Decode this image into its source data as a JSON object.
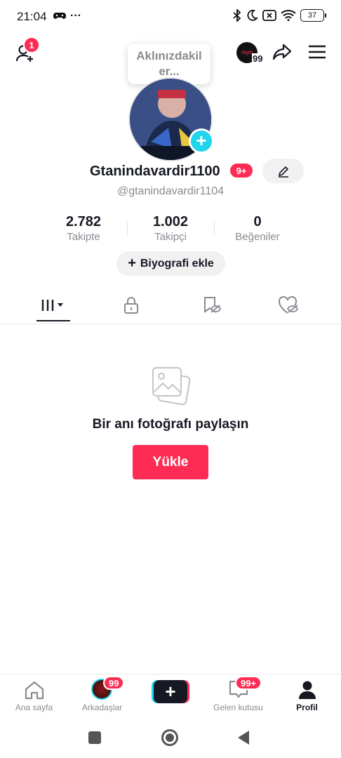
{
  "status_bar": {
    "time": "21:04",
    "dots": "···",
    "battery": "37"
  },
  "top_bar": {
    "add_friend_badge": "1",
    "story_count": "99",
    "avatar_small_text": "Night"
  },
  "bubble": {
    "text_line1": "Aklınızdakil",
    "text_line2": "er..."
  },
  "profile": {
    "username": "Gtanindavardir1100",
    "username_badge": "9+",
    "handle": "@gtanindavardir1104"
  },
  "stats": [
    {
      "value": "2.782",
      "label": "Takipte"
    },
    {
      "value": "1.002",
      "label": "Takipçi"
    },
    {
      "value": "0",
      "label": "Beğeniler"
    }
  ],
  "bio_button": {
    "plus": "+",
    "label": "Biyografi ekle"
  },
  "empty_state": {
    "text": "Bir anı fotoğrafı paylaşın",
    "button": "Yükle"
  },
  "bottom_nav": {
    "home": "Ana sayfa",
    "friends": "Arkadaşlar",
    "friends_badge": "99",
    "create": "+",
    "inbox": "Gelen kutusu",
    "inbox_badge": "99+",
    "profile": "Profil"
  },
  "colors": {
    "accent": "#fe2c55",
    "cyan": "#20d5ec",
    "text": "#161823",
    "muted": "#8a8b91"
  }
}
